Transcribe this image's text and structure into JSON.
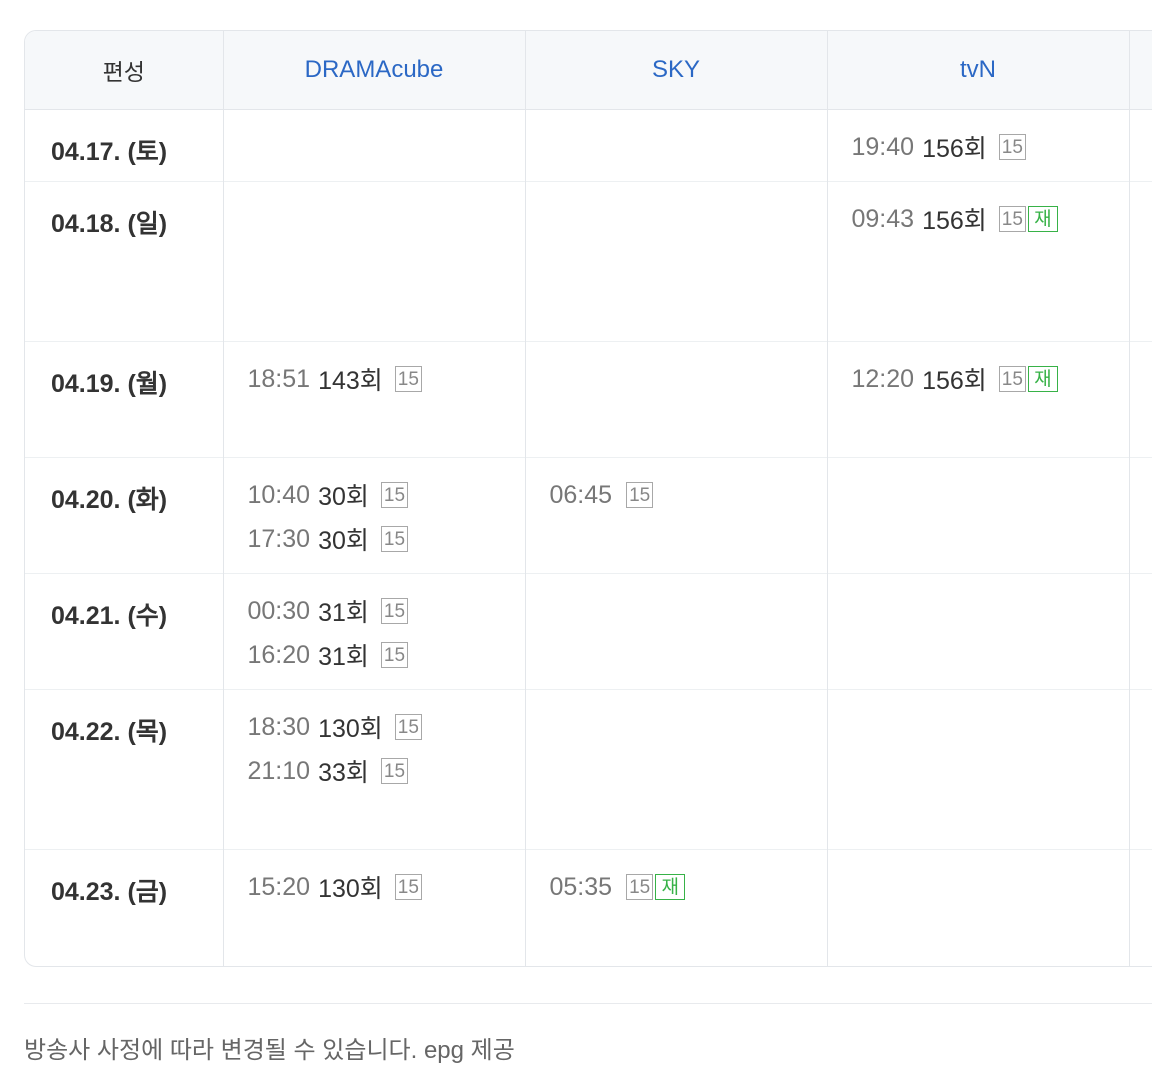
{
  "header": {
    "corner": "편성",
    "channels": [
      "DRAMAcube",
      "SKY",
      "tvN",
      ""
    ]
  },
  "rows": [
    {
      "date": "04.17. (토)",
      "height": 72,
      "cells": [
        [],
        [],
        [
          {
            "time": "19:40",
            "ep": "156회",
            "rating": "15",
            "rerun": ""
          }
        ],
        []
      ]
    },
    {
      "date": "04.18. (일)",
      "height": 160,
      "cells": [
        [],
        [],
        [
          {
            "time": "09:43",
            "ep": "156회",
            "rating": "15",
            "rerun": "재"
          }
        ],
        []
      ]
    },
    {
      "date": "04.19. (월)",
      "height": 116,
      "cells": [
        [
          {
            "time": "18:51",
            "ep": "143회",
            "rating": "15",
            "rerun": ""
          }
        ],
        [],
        [
          {
            "time": "12:20",
            "ep": "156회",
            "rating": "15",
            "rerun": "재"
          }
        ],
        []
      ]
    },
    {
      "date": "04.20. (화)",
      "height": 116,
      "cells": [
        [
          {
            "time": "10:40",
            "ep": "30회",
            "rating": "15",
            "rerun": ""
          },
          {
            "time": "17:30",
            "ep": "30회",
            "rating": "15",
            "rerun": ""
          }
        ],
        [
          {
            "time": "06:45",
            "ep": "",
            "rating": "15",
            "rerun": ""
          }
        ],
        [],
        []
      ]
    },
    {
      "date": "04.21. (수)",
      "height": 116,
      "cells": [
        [
          {
            "time": "00:30",
            "ep": "31회",
            "rating": "15",
            "rerun": ""
          },
          {
            "time": "16:20",
            "ep": "31회",
            "rating": "15",
            "rerun": ""
          }
        ],
        [],
        [],
        []
      ]
    },
    {
      "date": "04.22. (목)",
      "height": 160,
      "cells": [
        [
          {
            "time": "18:30",
            "ep": "130회",
            "rating": "15",
            "rerun": ""
          },
          {
            "time": "21:10",
            "ep": "33회",
            "rating": "15",
            "rerun": ""
          }
        ],
        [],
        [],
        []
      ]
    },
    {
      "date": "04.23. (금)",
      "height": 116,
      "cells": [
        [
          {
            "time": "15:20",
            "ep": "130회",
            "rating": "15",
            "rerun": ""
          }
        ],
        [
          {
            "time": "05:35",
            "ep": "",
            "rating": "15",
            "rerun": "재"
          }
        ],
        [],
        []
      ]
    }
  ],
  "footer": {
    "note": "방송사 사정에 따라 변경될 수 있습니다. epg 제공"
  },
  "colors": {
    "channel_link": "#2b68c5",
    "rerun_badge": "#37b247",
    "rating_badge": "#a8a8a8"
  }
}
